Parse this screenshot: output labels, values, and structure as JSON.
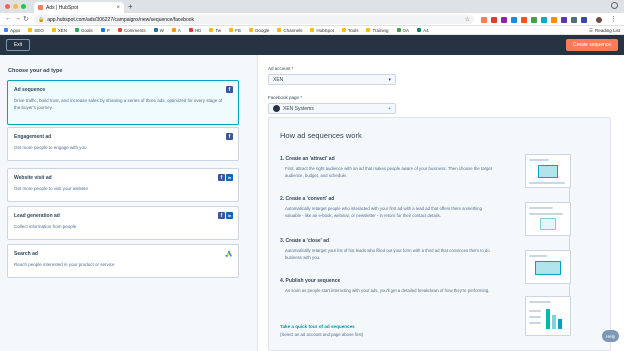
{
  "browser": {
    "tab_title": "Ads | HubSpot",
    "url": "app.hubspot.com/ads/306227/campaigns/new/sequence/facebook",
    "bookmarks": [
      "Apps",
      "SEO",
      "XEN",
      "Goals",
      "P",
      "Comments",
      "W",
      "A",
      "HD",
      "Tw",
      "FB",
      "Google",
      "Channels",
      "HubSpot",
      "Tools",
      "Training",
      "OA",
      "A4"
    ],
    "reading_list": "Reading List"
  },
  "header": {
    "exit_label": "Exit",
    "create_label": "Create sequence"
  },
  "left": {
    "heading": "Choose your ad type",
    "cards": [
      {
        "title": "Ad sequence",
        "desc": "Drive traffic, build trust, and increase sales by showing a series of three ads, optimized for every stage of the buyer's journey."
      },
      {
        "title": "Engagement ad",
        "desc": "Get more people to engage with you"
      },
      {
        "title": "Website visit ad",
        "desc": "Get more people to visit your website"
      },
      {
        "title": "Lead generation ad",
        "desc": "Collect information from people"
      },
      {
        "title": "Search ad",
        "desc": "Reach people interested in your product or service"
      }
    ]
  },
  "right": {
    "ad_account_label": "Ad account *",
    "ad_account_value": "XEN",
    "fb_page_label": "Facebook page *",
    "fb_page_value": "XEN Systems",
    "how_title": "How ad sequences work",
    "steps": [
      {
        "title": "1. Create an 'attract' ad",
        "desc": "First, attract the right audience with an ad that makes people aware of your business. Then choose the target audience, budget, and schedule."
      },
      {
        "title": "2. Create a 'convert' ad",
        "desc": "Automatically retarget people who interacted with your first ad with a lead ad that offers them something valuable - like an e-book, webinar, or newsletter - in return for their contact details."
      },
      {
        "title": "3. Create a 'close' ad",
        "desc": "Automatically retarget your list of hot leads who filled out your form with a third ad that convinces them to do business with you."
      },
      {
        "title": "4. Publish your sequence",
        "desc": "As soon as people start interacting with your ads, you'll get a detailed breakdown of how they're performing."
      }
    ],
    "tour_link": "Take a quick tour of ad sequences",
    "tour_note": "(Select an ad account and page above first)"
  },
  "help_label": "Help",
  "colors": {
    "accent": "#ff7a59",
    "header_bg": "#253342",
    "selected_border": "#00a4bd",
    "link": "#0091ae"
  }
}
